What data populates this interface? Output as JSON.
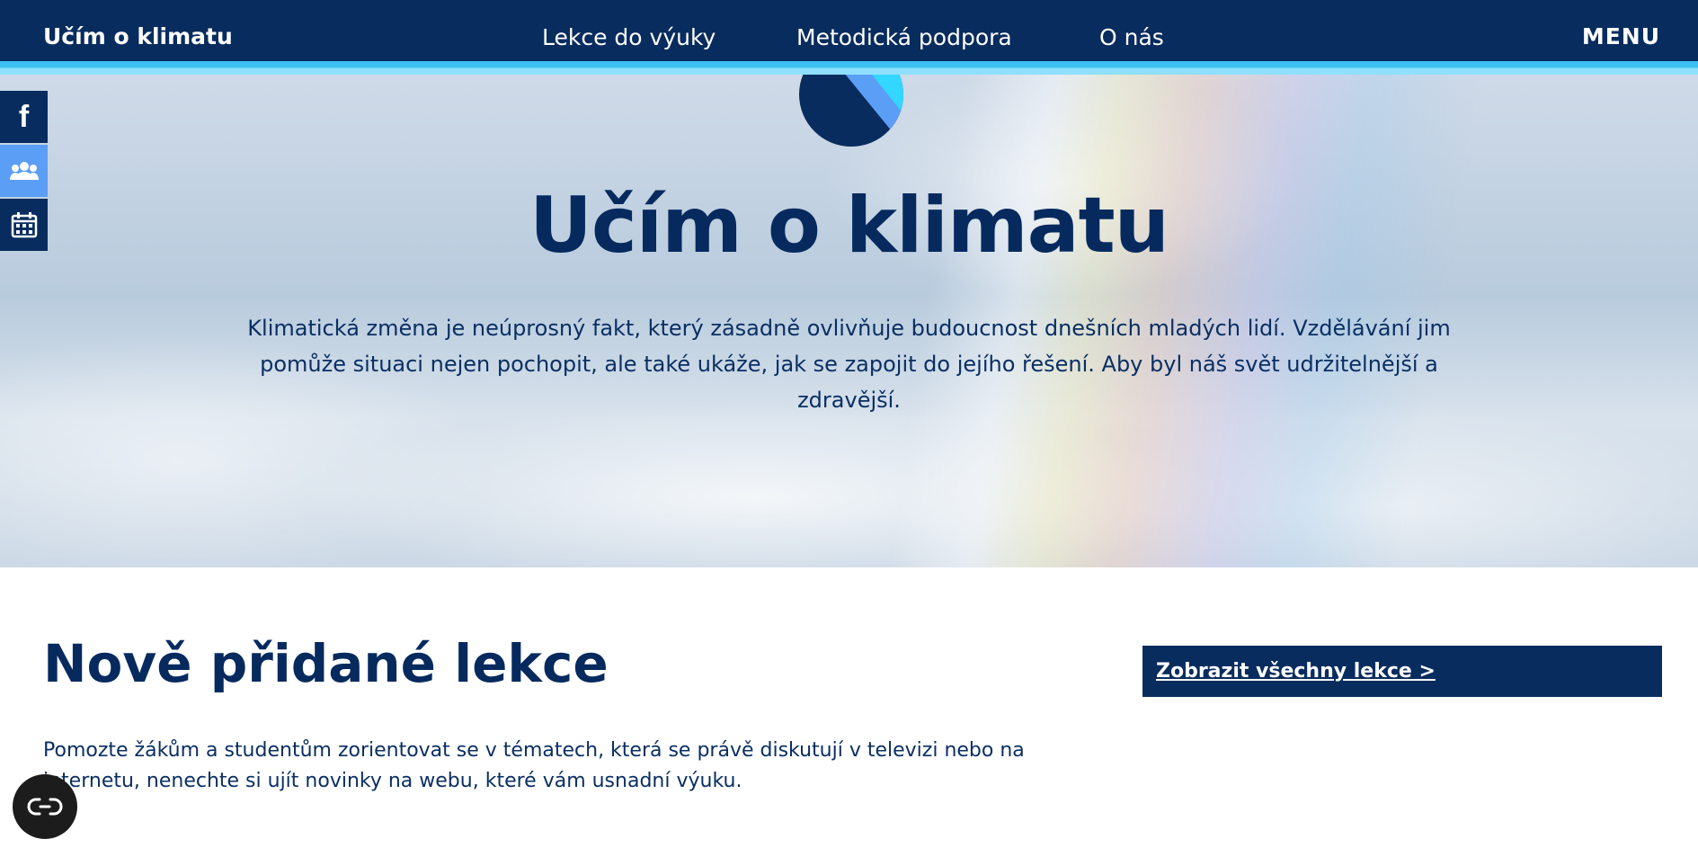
{
  "header": {
    "logo": "Učím o klimatu",
    "nav": [
      "Lekce do výuky",
      "Metodická podpora",
      "O nás"
    ],
    "menu_label": "MENU"
  },
  "hero": {
    "title": "Učím o klimatu",
    "text": "Klimatická změna je neúprosný fakt, který zásadně ovlivňuje budoucnost dnešních mladých lidí. Vzdělávání jim pomůže situaci nejen pochopit, ale také ukáže, jak se zapojit do jejího řešení. Aby byl náš svět udržitelnější a zdravější."
  },
  "social": {
    "facebook_glyph": "f",
    "icons": [
      "facebook-icon",
      "group-icon",
      "calendar-icon"
    ]
  },
  "section": {
    "title": "Nově přidané lekce",
    "text": "Pomozte žákům a studentům zorientovat se v tématech, která se právě diskutují v televizi nebo na internetu, nenechte si ujít novinky na webu, které vám usnadní výuku.",
    "button_label": "Zobrazit všechny lekce >"
  },
  "colors": {
    "navy": "#082c5e",
    "accent_blue": "#5b9ef5",
    "cyan": "#3ec1f2"
  }
}
